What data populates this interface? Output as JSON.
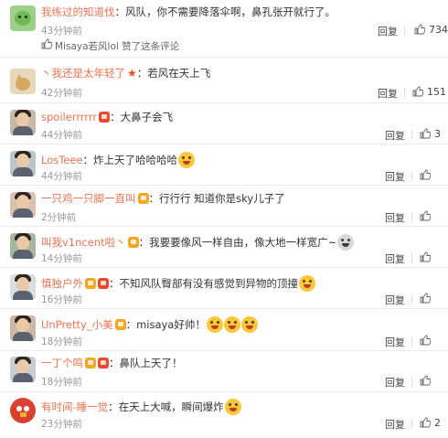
{
  "comments": [
    {
      "username": "我练过的知道伐",
      "badges": [],
      "text": "风队，你不需要降落伞啊，鼻孔张开就行了。",
      "emojis": [],
      "time": "43分钟前",
      "liked_note": "Misaya若风lol 赞了这条评论",
      "reply_label": "回复",
      "likes": "734",
      "avatar": "green-cartoon"
    },
    {
      "username": "丶我还是太年轻了",
      "badges": [
        "star"
      ],
      "text": "若风在天上飞",
      "emojis": [],
      "time": "42分钟前",
      "reply_label": "回复",
      "likes": "151",
      "avatar": "cat"
    },
    {
      "username": "spoilerrrrrr",
      "badges": [
        "red"
      ],
      "text": "大鼻子会飞",
      "emojis": [],
      "time": "44分钟前",
      "reply_label": "回复",
      "likes": "3",
      "avatar": "man-dark"
    },
    {
      "username": "LosTeee",
      "badges": [],
      "text": "炸上天了哈哈哈哈",
      "emojis": [
        "laugh-cry"
      ],
      "time": "44分钟前",
      "reply_label": "回复",
      "likes": "",
      "avatar": "man-portrait"
    },
    {
      "username": "一只鸡一只脚一直叫",
      "badges": [
        "vip"
      ],
      "text": "行行行 知道你是sky儿子了",
      "emojis": [],
      "time": "2分钟前",
      "reply_label": "回复",
      "likes": "",
      "avatar": "girl"
    },
    {
      "username": "叫我v1ncent啦丶",
      "badges": [
        "vip"
      ],
      "text": "我要要像风一样自由，像大地一样宽广~",
      "emojis": [
        "husky"
      ],
      "time": "14分钟前",
      "reply_label": "回复",
      "likes": "",
      "avatar": "man-outdoor"
    },
    {
      "username": "慎独户外",
      "badges": [
        "vip",
        "red"
      ],
      "text": "不知风队臀部有没有感觉到异物的顶撞",
      "emojis": [
        "laugh"
      ],
      "time": "16分钟前",
      "reply_label": "回复",
      "likes": "",
      "avatar": "man-white"
    },
    {
      "username": "UnPretty_小美",
      "badges": [
        "vip"
      ],
      "text": "misaya好帅！",
      "emojis": [
        "shock",
        "shock",
        "shock"
      ],
      "time": "18分钟前",
      "reply_label": "回复",
      "likes": "",
      "avatar": "woman"
    },
    {
      "username": "一丁个鸣",
      "badges": [
        "vip",
        "red"
      ],
      "text": "鼻队上天了！",
      "emojis": [],
      "time": "18分钟前",
      "reply_label": "回复",
      "likes": "",
      "avatar": "man-suit"
    },
    {
      "username": "有时间-睡一觉",
      "badges": [],
      "text": "在天上大喊，瞬间爆炸",
      "emojis": [
        "laugh-cry"
      ],
      "time": "23分钟前",
      "reply_label": "回复",
      "likes": "2",
      "avatar": "angry-bird"
    }
  ],
  "colors": {
    "username": "#eb7350",
    "time": "#999999",
    "divider": "#ebebeb"
  }
}
